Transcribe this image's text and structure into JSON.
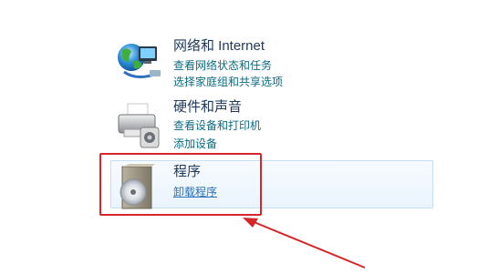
{
  "categories": [
    {
      "title": "网络和 Internet",
      "links": [
        "查看网络状态和任务",
        "选择家庭组和共享选项"
      ],
      "icon": "network-globe-icon"
    },
    {
      "title": "硬件和声音",
      "links": [
        "查看设备和打印机",
        "添加设备"
      ],
      "icon": "printer-icon"
    },
    {
      "title": "程序",
      "links": [
        "卸载程序"
      ],
      "icon": "programs-disc-box-icon"
    }
  ],
  "colors": {
    "title": "#1e395b",
    "link": "#0d6b82",
    "highlight_border": "#c6def4",
    "annotation_red": "#d6262a"
  }
}
